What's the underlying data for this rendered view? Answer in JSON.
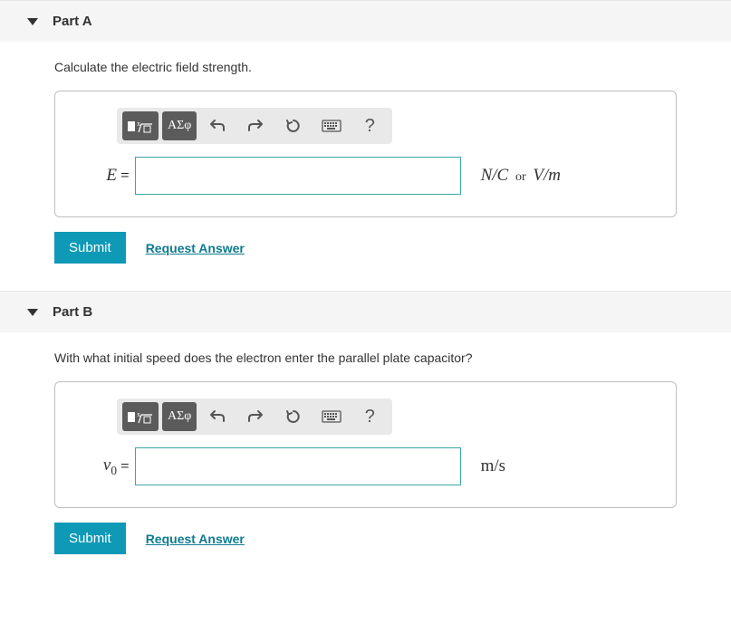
{
  "partA": {
    "title": "Part A",
    "question": "Calculate the electric field strength.",
    "toolbar": {
      "templates_label": "∎√□",
      "greek_label": "ΑΣφ",
      "help": "?"
    },
    "variable": "E",
    "equals": "=",
    "unit_prefix": "N/C",
    "unit_or": "or",
    "unit_suffix": "V/m",
    "submit": "Submit",
    "request": "Request Answer"
  },
  "partB": {
    "title": "Part B",
    "question": "With what initial speed does the electron enter the parallel plate capacitor?",
    "toolbar": {
      "templates_label": "∎√□",
      "greek_label": "ΑΣφ",
      "help": "?"
    },
    "variable": "v",
    "variable_sub": "0",
    "equals": "=",
    "unit": "m/s",
    "submit": "Submit",
    "request": "Request Answer"
  }
}
